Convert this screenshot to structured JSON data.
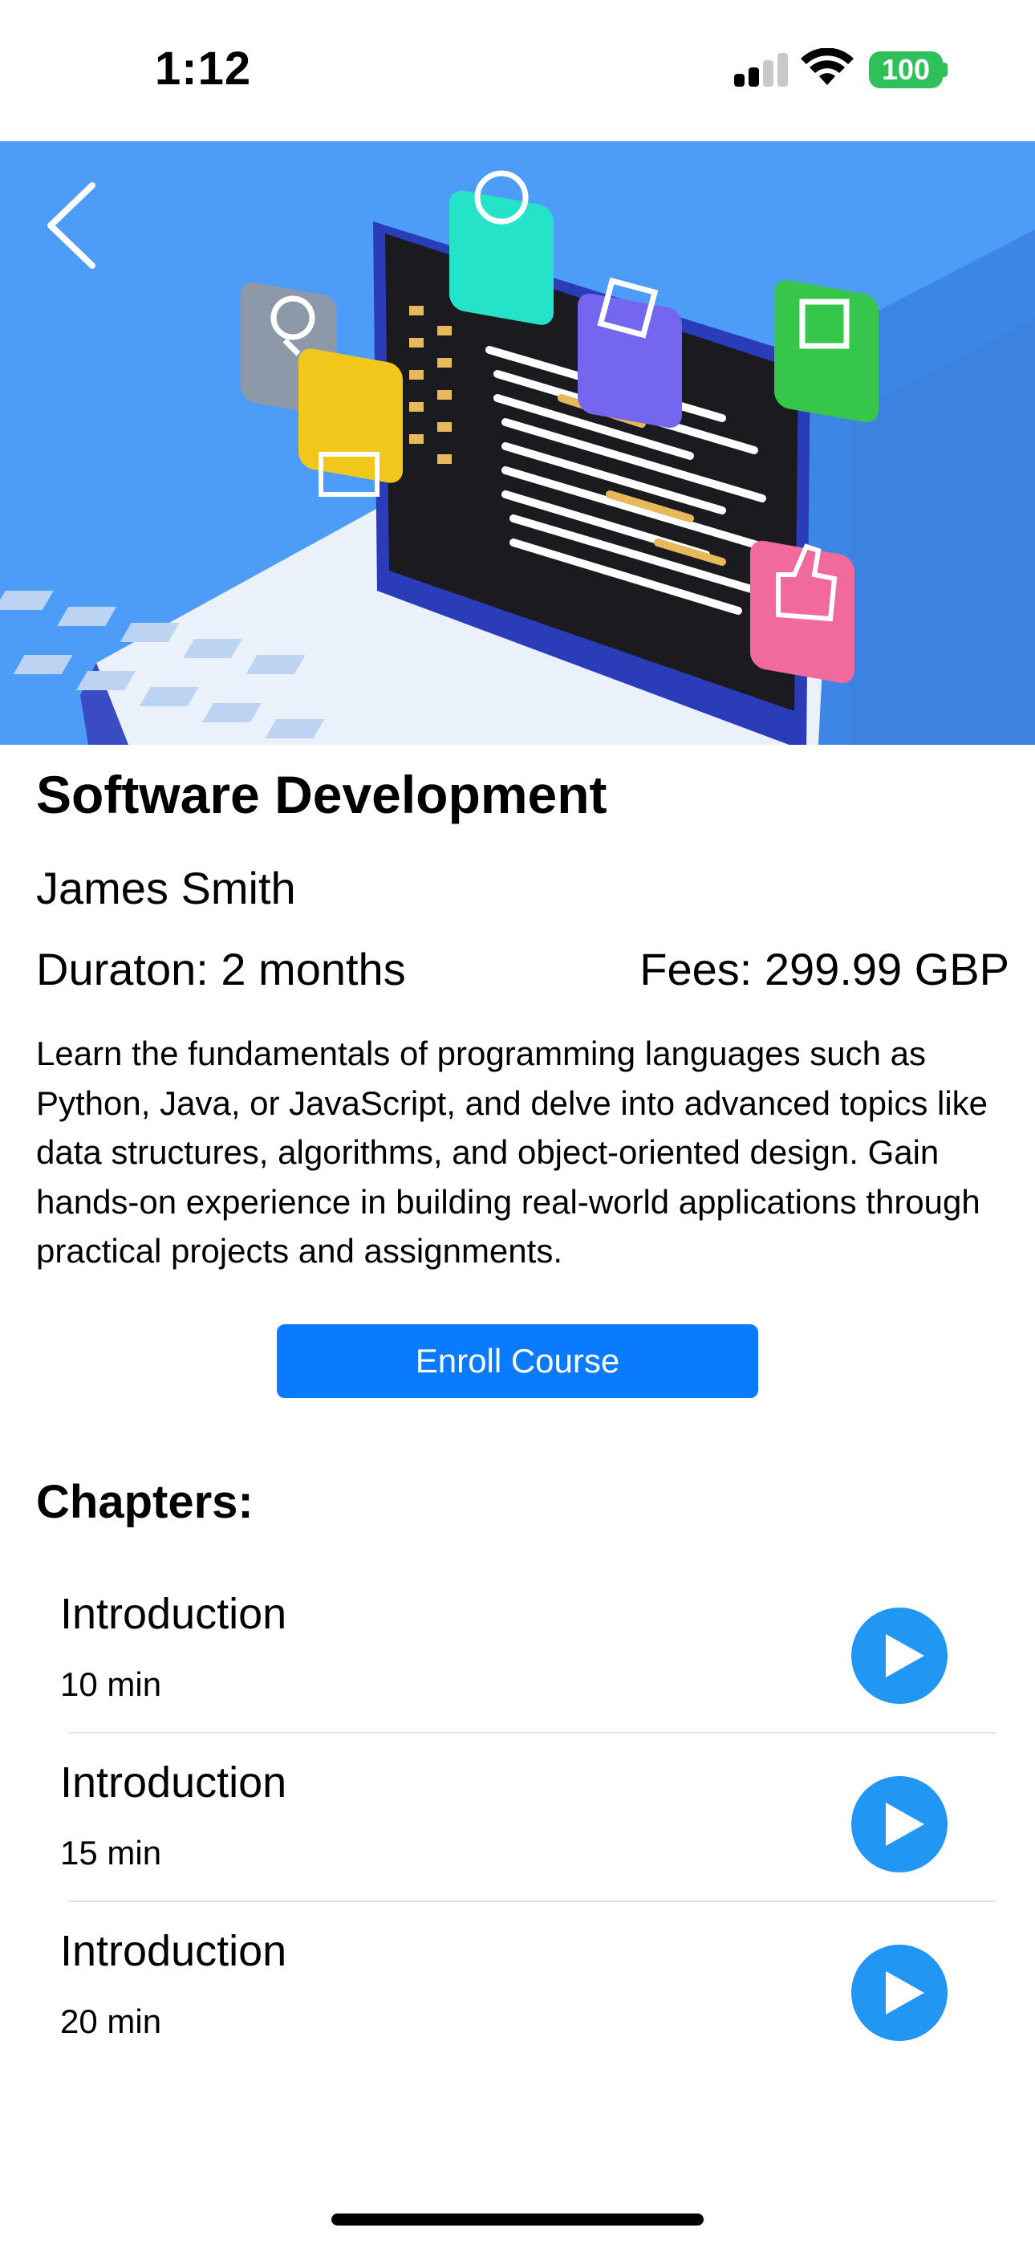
{
  "status_bar": {
    "time": "1:12",
    "battery": "100",
    "battery_color": "#30c05a"
  },
  "hero": {
    "image": "course-banner-laptop-illustration",
    "back_icon": "chevron-left-icon"
  },
  "course": {
    "title": "Software Development",
    "instructor": "James Smith",
    "duration": "Duraton: 2 months",
    "fees": "Fees: 299.99 GBP",
    "description": "Learn the fundamentals of programming languages such as Python, Java, or JavaScript, and delve into advanced topics like data structures, algorithms, and object-oriented design. Gain hands-on experience in building real-world applications through practical projects and assignments."
  },
  "enroll": {
    "label": "Enroll Course",
    "color": "#0a7aff"
  },
  "chapters": {
    "heading": "Chapters:",
    "play_icon": "play-circle-icon",
    "play_color": "#2196f3",
    "items": [
      {
        "title": "Introduction",
        "duration": "10 min"
      },
      {
        "title": "Introduction",
        "duration": "15 min"
      },
      {
        "title": "Introduction",
        "duration": "20 min"
      }
    ]
  }
}
